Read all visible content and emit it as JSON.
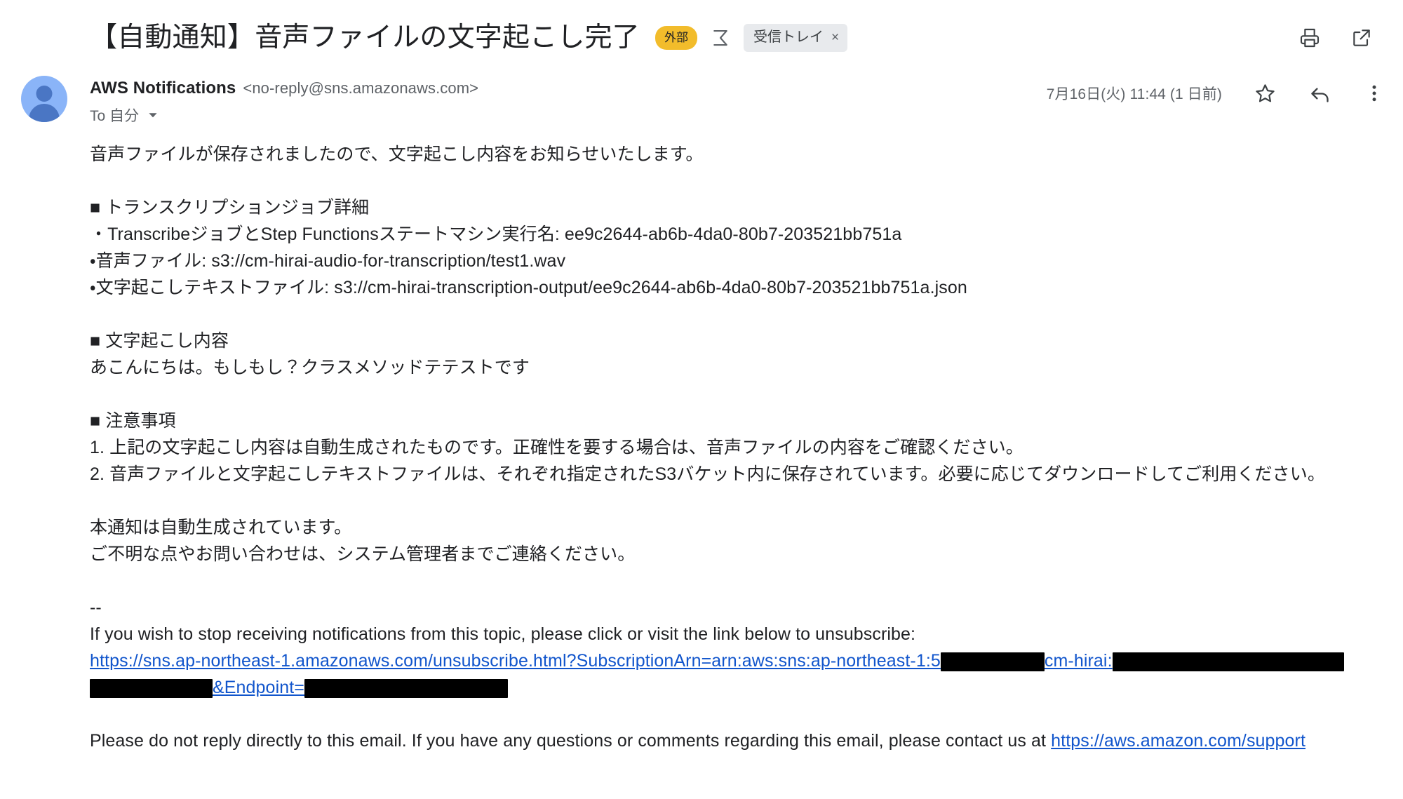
{
  "subject": {
    "text": "【自動通知】音声ファイルの文字起こし完了",
    "external_badge": "外部",
    "thread_icon": "sigma-thread-icon",
    "label_chip": "受信トレイ",
    "label_chip_close": "×"
  },
  "subject_actions": {
    "print": "print-icon",
    "popout": "open-in-new-icon"
  },
  "header": {
    "sender_name": "AWS Notifications",
    "sender_email": "<no-reply@sns.amazonaws.com>",
    "to_label": "To 自分",
    "timestamp": "7月16日(火) 11:44 (1 日前)",
    "star": "star-icon",
    "reply": "reply-icon",
    "more": "more-vert-icon"
  },
  "body": {
    "intro": "音声ファイルが保存されましたので、文字起こし内容をお知らせいたします。",
    "section_job_title": "■ トランスクリプションジョブ詳細",
    "job_lines": [
      "・TranscribeジョブとStep Functionsステートマシン実行名: ee9c2644-ab6b-4da0-80b7-203521bb751a",
      "・音声ファイル: s3://cm-hirai-audio-for-transcription/test1.wav",
      "・文字起こしテキストファイル: s3://cm-hirai-transcription-output/ee9c2644-ab6b-4da0-80b7-203521bb751a.json"
    ],
    "section_transcript_title": "■ 文字起こし内容",
    "transcript": "あこんにちは。もしもし？クラスメソッドテテストです",
    "section_notes_title": "■ 注意事項",
    "notes": [
      "1. 上記の文字起こし内容は自動生成されたものです。正確性を要する場合は、音声ファイルの内容をご確認ください。",
      "2. 音声ファイルと文字起こしテキストファイルは、それぞれ指定されたS3バケット内に保存されています。必要に応じてダウンロードしてご利用ください。"
    ],
    "auto_note_1": "本通知は自動生成されています。",
    "auto_note_2": "ご不明な点やお問い合わせは、システム管理者までご連絡ください。",
    "signature_separator": "--",
    "unsubscribe_intro": "If you wish to stop receiving notifications from this topic, please click or visit the link below to unsubscribe:",
    "unsubscribe_link_part1": "https://sns.ap-northeast-1.amazonaws.com/unsubscribe.html?SubscriptionArn=arn:aws:sns:ap-northeast-1:5",
    "unsubscribe_link_part2": "cm-hirai:",
    "unsubscribe_link_part3": "&Endpoint=",
    "contact_text_before": "Please do not reply directly to this email. If you have any questions or comments regarding this email, please contact us at ",
    "support_link": "https://aws.amazon.com/support"
  },
  "colors": {
    "external_badge_bg": "#f2bc2b",
    "label_chip_bg": "#e8eaed",
    "link": "#1155cc",
    "text": "#202124",
    "muted": "#5f6368",
    "avatar_bg": "#8ab4f8"
  }
}
